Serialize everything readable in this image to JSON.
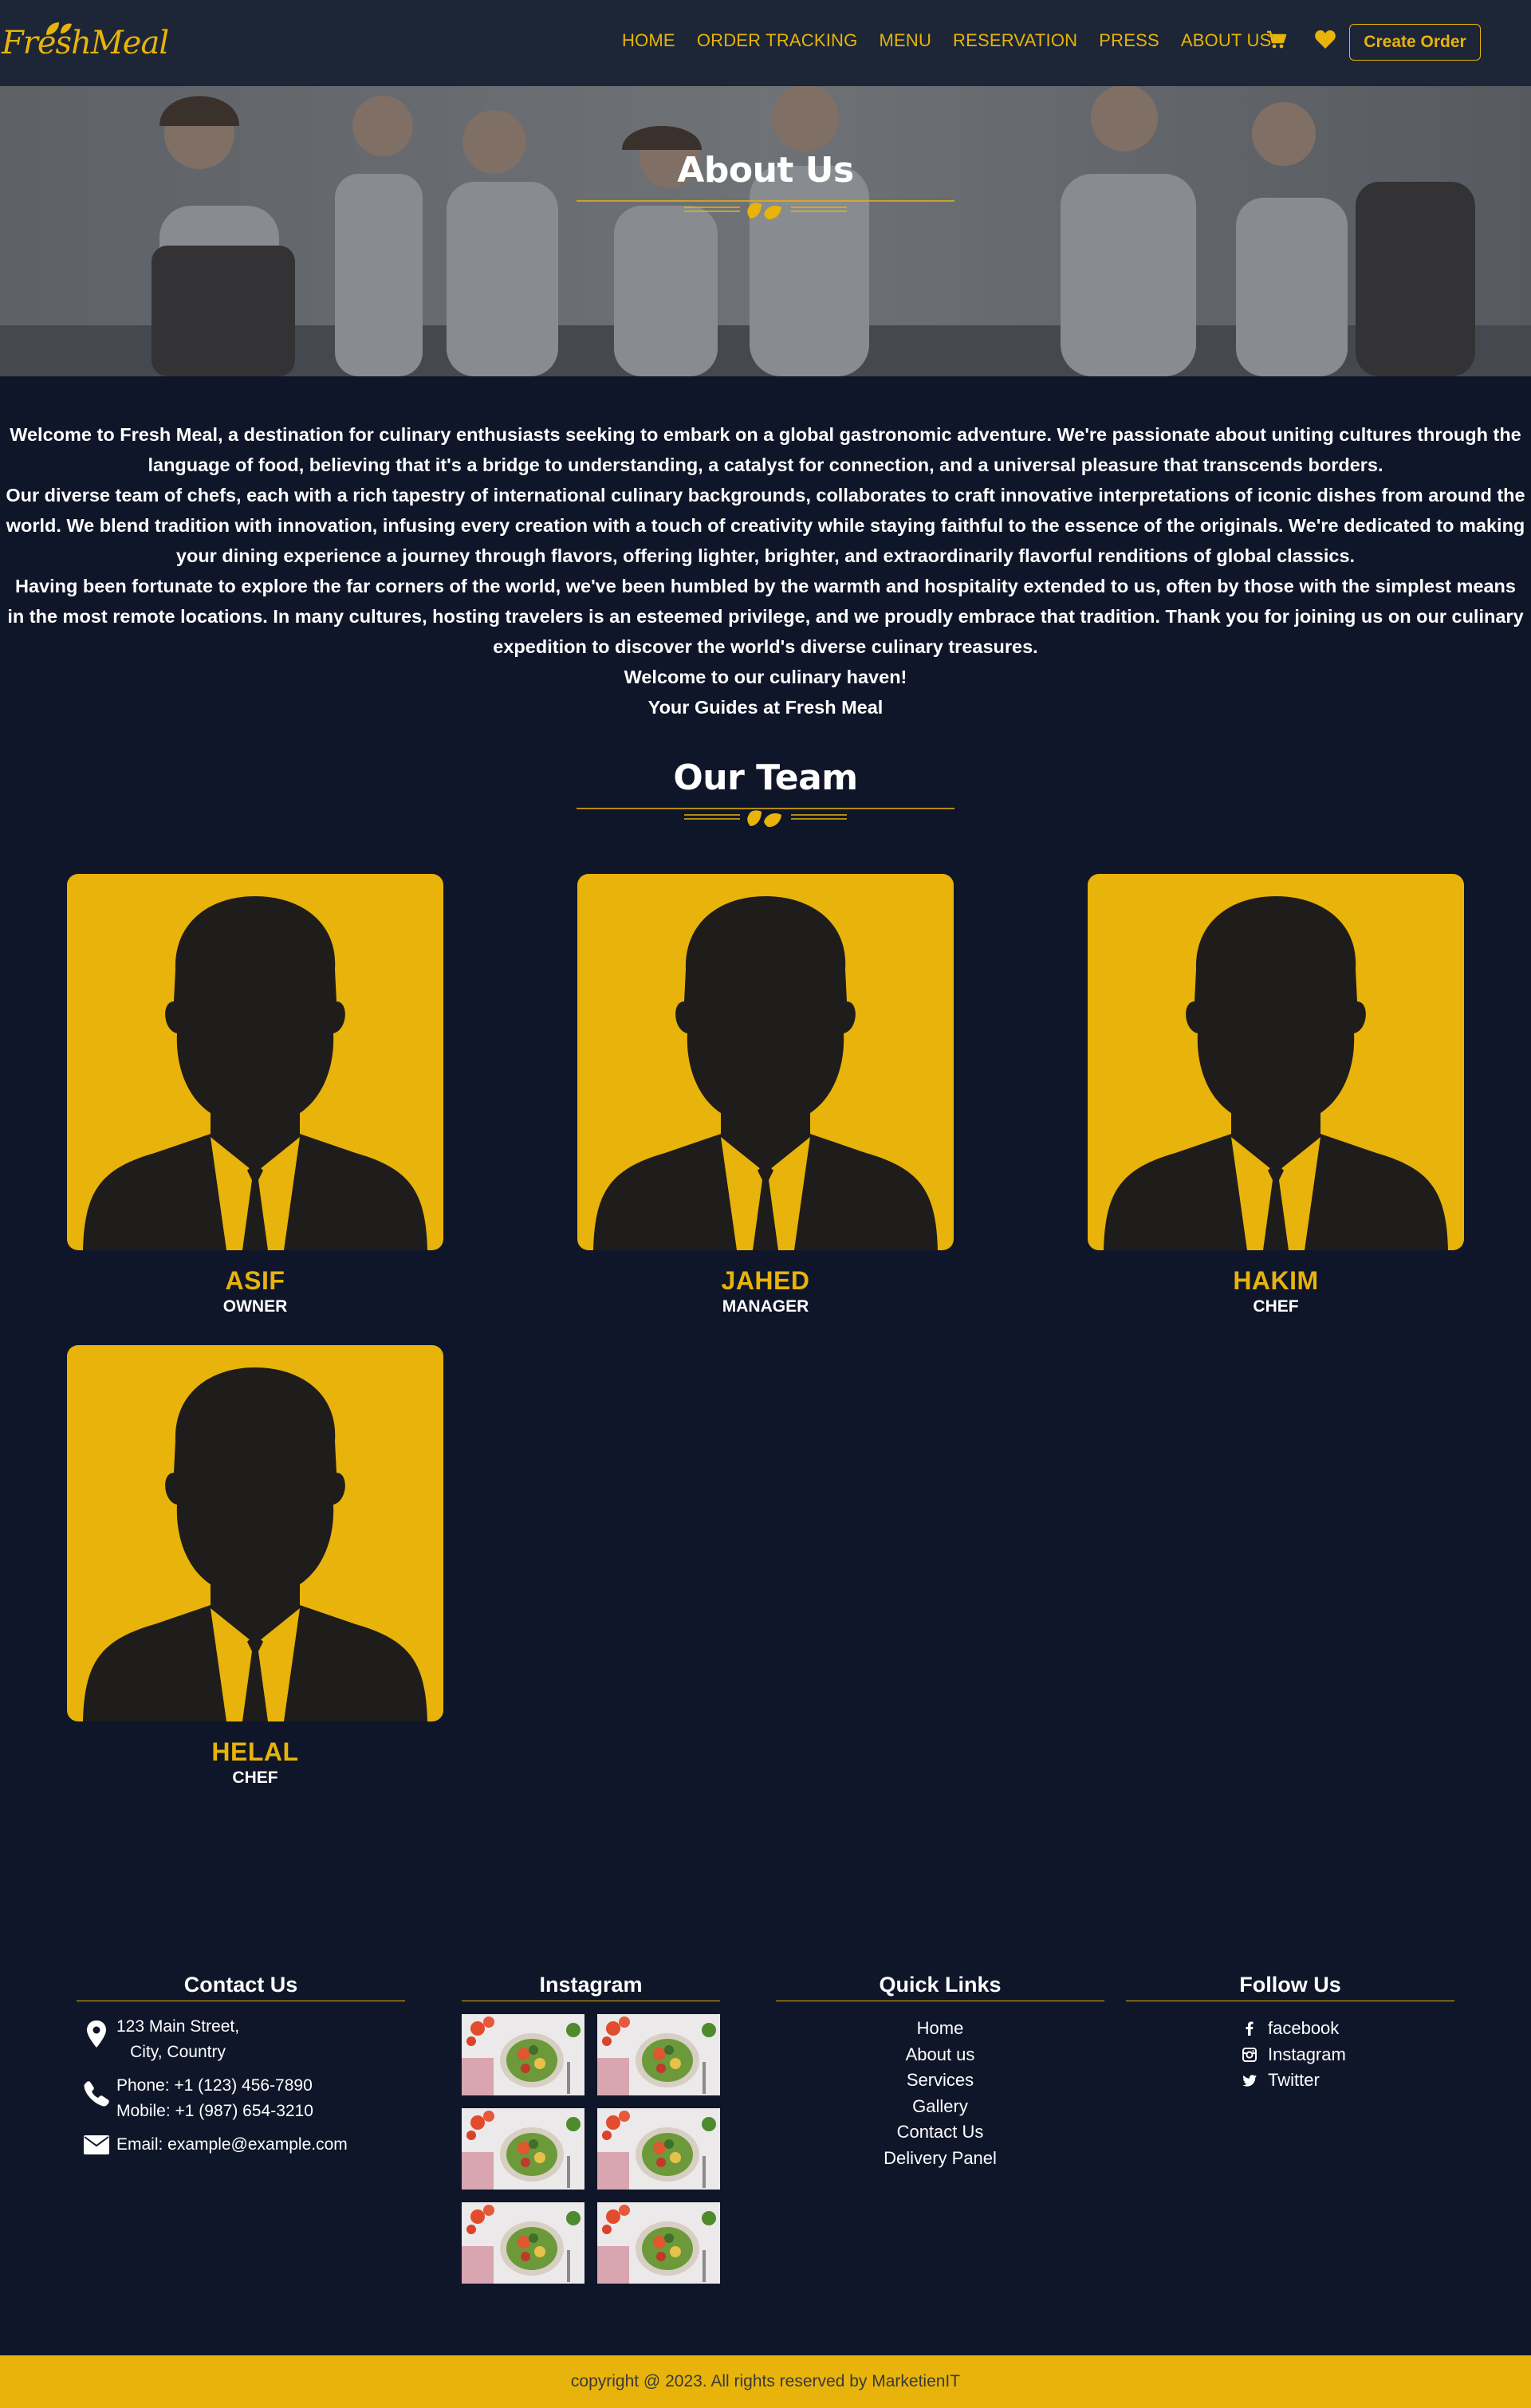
{
  "brand": {
    "logo_text": "FreshMeal",
    "accent": "#e8b30a",
    "nav_bg": "#1c2636",
    "page_bg": "#0f1629"
  },
  "nav": {
    "links": [
      "HOME",
      "ORDER TRACKING",
      "MENU",
      "RESERVATION",
      "PRESS",
      "ABOUT US"
    ],
    "cart_icon": "cart-icon",
    "heart_icon": "heart-icon",
    "cta_label": "Create Order"
  },
  "hero": {
    "title": "About Us"
  },
  "about": {
    "paragraphs": [
      "Welcome to Fresh Meal, a destination for culinary enthusiasts seeking to embark on a global gastronomic adventure. We're passionate about uniting cultures through the language of food, believing that it's a bridge to understanding, a catalyst for connection, and a universal pleasure that transcends borders.",
      "Our diverse team of chefs, each with a rich tapestry of international culinary backgrounds, collaborates to craft innovative interpretations of iconic dishes from around the world. We blend tradition with innovation, infusing every creation with a touch of creativity while staying faithful to the essence of the originals. We're dedicated to making your dining experience a journey through flavors, offering lighter, brighter, and extraordinarily flavorful renditions of global classics.",
      "Having been fortunate to explore the far corners of the world, we've been humbled by the warmth and hospitality extended to us, often by those with the simplest means in the most remote locations. In many cultures, hosting travelers is an esteemed privilege, and we proudly embrace that tradition. Thank you for joining us on our culinary expedition to discover the world's diverse culinary treasures.",
      "Welcome to our culinary haven!",
      "Your Guides at Fresh Meal"
    ]
  },
  "team": {
    "title": "Our Team",
    "members": [
      {
        "name": "ASIF",
        "role": "OWNER"
      },
      {
        "name": "JAHED",
        "role": "MANAGER"
      },
      {
        "name": "HAKIM",
        "role": "CHEF"
      },
      {
        "name": "HELAL",
        "role": "CHEF"
      }
    ]
  },
  "footer": {
    "contact": {
      "heading": "Contact Us",
      "address_line1": "123 Main Street,",
      "address_line2": "City, Country",
      "phone": "Phone: +1 (123) 456-7890",
      "mobile": "Mobile: +1 (987) 654-3210",
      "email": "Email: example@example.com"
    },
    "instagram": {
      "heading": "Instagram",
      "thumb_count": 6
    },
    "quick_links": {
      "heading": "Quick Links",
      "items": [
        "Home",
        "About us",
        "Services",
        "Gallery",
        "Contact Us",
        "Delivery Panel"
      ]
    },
    "follow": {
      "heading": "Follow Us",
      "items": [
        {
          "label": "facebook",
          "icon": "facebook-icon"
        },
        {
          "label": "Instagram",
          "icon": "instagram-icon"
        },
        {
          "label": "Twitter",
          "icon": "twitter-icon"
        }
      ]
    },
    "copyright": "copyright @ 2023. All rights reserved by MarketienIT"
  }
}
